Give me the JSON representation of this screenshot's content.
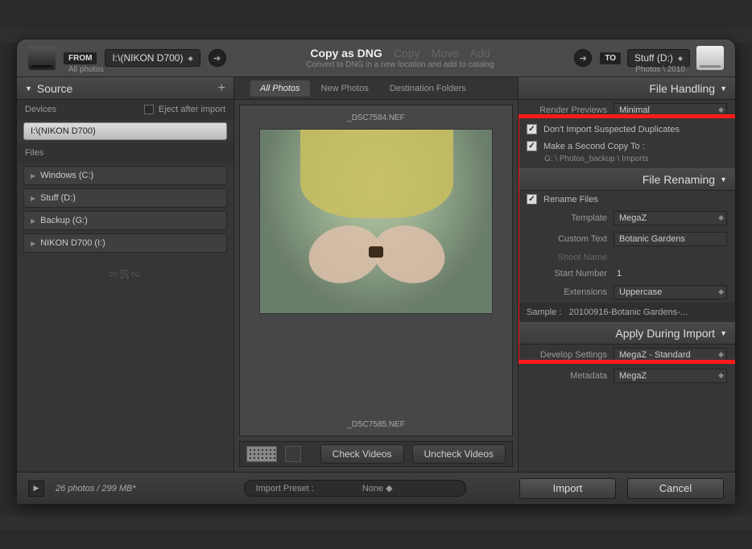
{
  "top": {
    "from_tag": "FROM",
    "from_path": "I:\\(NIKON D700)",
    "from_sub": "All photos",
    "modes": {
      "copy_dng": "Copy as DNG",
      "copy": "Copy",
      "move": "Move",
      "add": "Add"
    },
    "mode_sub": "Convert to DNG in a new location and add to catalog",
    "to_tag": "TO",
    "to_path": "Stuff (D:)",
    "to_sub": "Photos \\ 2010"
  },
  "left": {
    "source_hdr": "Source",
    "devices_hdr": "Devices",
    "eject_label": "Eject after import",
    "device_selected": "I:\\(NIKON D700)",
    "files_hdr": "Files",
    "folders": [
      "Windows (C:)",
      "Stuff (D:)",
      "Backup (G:)",
      "NIKON D700 (I:)"
    ]
  },
  "mid": {
    "tabs": [
      "All Photos",
      "New Photos",
      "Destination Folders"
    ],
    "file1": "_DSC7584.NEF",
    "file2": "_DSC7585.NEF",
    "check_btn": "Check Videos",
    "uncheck_btn": "Uncheck Videos"
  },
  "right": {
    "file_handling_hdr": "File Handling",
    "render_label": "Render Previews",
    "render_value": "Minimal",
    "dup_label": "Don't Import Suspected Duplicates",
    "second_copy_label": "Make a Second Copy To :",
    "second_copy_path": "G: \\ Photos_backup \\ Imports",
    "file_renaming_hdr": "File Renaming",
    "rename_label": "Rename Files",
    "template_label": "Template",
    "template_value": "MegaZ",
    "custom_label": "Custom Text",
    "custom_value": "Botanic Gardens",
    "shoot_label": "Shoot Name",
    "startnum_label": "Start Number",
    "startnum_value": "1",
    "ext_label": "Extensions",
    "ext_value": "Uppercase",
    "sample_label": "Sample :",
    "sample_value": "20100916-Botanic Gardens-...",
    "apply_hdr": "Apply During Import",
    "dev_label": "Develop Settings",
    "dev_value": "MegaZ - Standard",
    "meta_label": "Metadata",
    "meta_value": "MegaZ"
  },
  "bottom": {
    "status": "26 photos / 299 MB*",
    "preset_label": "Import Preset :",
    "preset_value": "None",
    "import_btn": "Import",
    "cancel_btn": "Cancel"
  }
}
